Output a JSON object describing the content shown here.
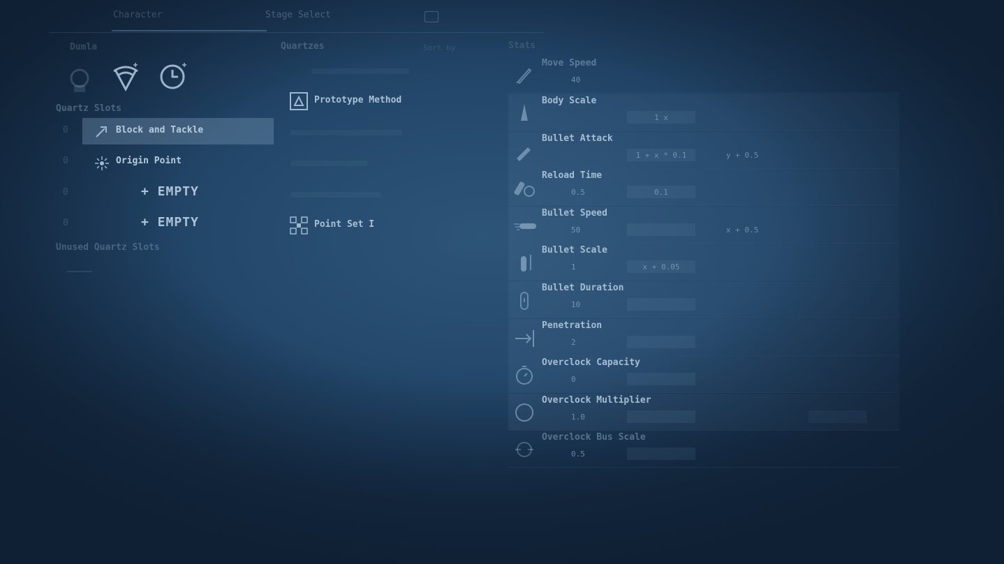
{
  "tabs": [
    {
      "label": "Character",
      "active": true
    },
    {
      "label": "Stage Select",
      "active": false
    }
  ],
  "left": {
    "title": "Dumla",
    "quartz_slots_title": "Quartz Slots",
    "unused_title": "Unused Quartz Slots",
    "slots": [
      {
        "num": "0",
        "label": "Block and Tackle",
        "icon": "block-tackle-icon",
        "selected": true
      },
      {
        "num": "0",
        "label": "Origin Point",
        "icon": "origin-point-icon",
        "selected": false
      },
      {
        "num": "0",
        "label": "+ EMPTY",
        "empty": true
      },
      {
        "num": "0",
        "label": "+ EMPTY",
        "empty": true
      }
    ]
  },
  "middle": {
    "title": "Quartzes",
    "sort_label": "Sort by",
    "items": [
      {
        "label": "Prototype Method",
        "icon": "prototype-icon",
        "faded": false
      },
      {
        "label": "Point Set I",
        "icon": "point-set-icon",
        "faded": false
      }
    ]
  },
  "stats": {
    "title": "Stats",
    "rows": [
      {
        "name": "Move Speed",
        "icon": "rocket-icon",
        "value": "40",
        "faded": true
      },
      {
        "name": "Body Scale",
        "icon": "ship-icon",
        "value": "",
        "box": "1 x"
      },
      {
        "name": "Bullet Attack",
        "icon": "bullet-attack-icon",
        "value": "",
        "box": "1 + x * 0.1",
        "fx": "y + 0.5"
      },
      {
        "name": "Reload Time",
        "icon": "reload-icon",
        "value": "0.5",
        "box": "0.1"
      },
      {
        "name": "Bullet Speed",
        "icon": "bullet-speed-icon",
        "value": "50",
        "fx": "x + 0.5"
      },
      {
        "name": "Bullet Scale",
        "icon": "bullet-scale-icon",
        "value": "1",
        "box": "x + 0.05"
      },
      {
        "name": "Bullet Duration",
        "icon": "bullet-duration-icon",
        "value": "10"
      },
      {
        "name": "Penetration",
        "icon": "penetration-icon",
        "value": "2"
      },
      {
        "name": "Overclock Capacity",
        "icon": "stopwatch-icon",
        "value": "0"
      },
      {
        "name": "Overclock Multiplier",
        "icon": "compass-icon",
        "value": "1.0"
      },
      {
        "name": "Overclock Bus Scale",
        "icon": "target-icon",
        "value": "0.5",
        "faded": true
      }
    ]
  }
}
